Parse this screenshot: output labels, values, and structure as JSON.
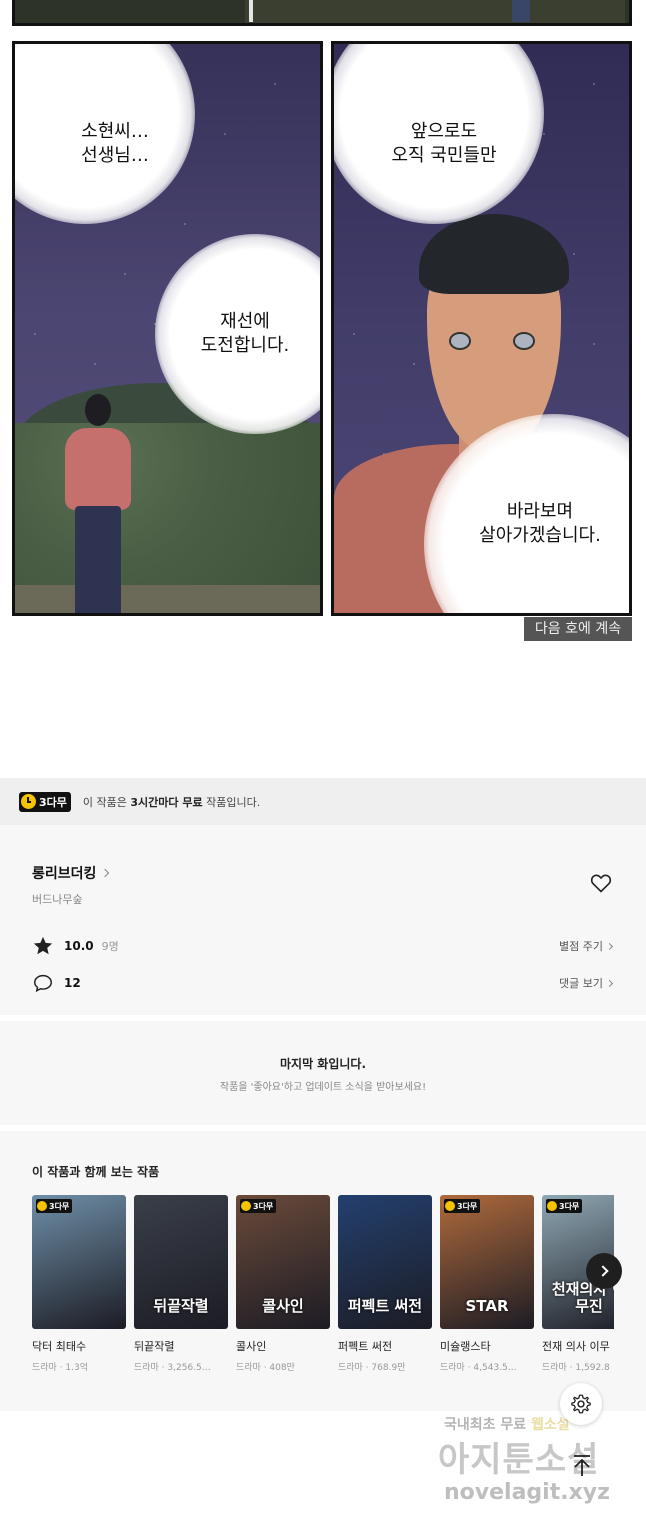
{
  "comic": {
    "bubble_1": "소현씨…\n선생님…",
    "bubble_2": "재선에\n도전합니다.",
    "bubble_3": "앞으로도\n오직 국민들만",
    "bubble_4": "바라보며\n살아가겠습니다.",
    "continued": "다음 호에 계속"
  },
  "free_banner": {
    "badge": "3다무",
    "text_prefix": "이 작품은 ",
    "text_bold": "3시간마다 무료",
    "text_suffix": " 작품입니다."
  },
  "work": {
    "title": "롱리브더킹",
    "author": "버드나무숲",
    "rating": "10.0",
    "rating_count": "9명",
    "rate_link": "별점 주기",
    "comment_count": "12",
    "comment_link": "댓글 보기"
  },
  "last_episode": {
    "title": "마지막 화입니다.",
    "subtitle": "작품을 '좋아요'하고 업데이트 소식을 받아보세요!"
  },
  "recommendations": {
    "heading": "이 작품과 함께 보는 작품",
    "items": [
      {
        "name": "닥터 최태수",
        "meta": "드라마 · 1.3억",
        "badge": "3다무",
        "thumb_text": "",
        "color": "#6f8fa8"
      },
      {
        "name": "뒤끝작렬",
        "meta": "드라마 · 3,256.5…",
        "badge": "",
        "thumb_text": "뒤끝작렬",
        "color": "#3a3f4a"
      },
      {
        "name": "콜사인",
        "meta": "드라마 · 408만",
        "badge": "3다무",
        "thumb_text": "콜사인",
        "color": "#6b4a3a"
      },
      {
        "name": "퍼펙트 써전",
        "meta": "드라마 · 768.9만",
        "badge": "",
        "thumb_text": "퍼펙트 써전",
        "color": "#23406e"
      },
      {
        "name": "미슐랭스타",
        "meta": "드라마 · 4,543.5…",
        "badge": "3다무",
        "thumb_text": "STAR",
        "color": "#b06a3c"
      },
      {
        "name": "전재 의사 이무",
        "meta": "드라마 · 1,592.8",
        "badge": "3다무",
        "thumb_text": "천재의사 이무진",
        "color": "#8fa8b4"
      }
    ]
  },
  "watermark": {
    "line1_a": "국내최초 무료",
    "line1_b": "웹소설",
    "line2": "아지툰소설",
    "line3": "novelagit.xyz"
  },
  "colors": {
    "accent": "#f5c400",
    "badge_bg": "#111111",
    "section_bg": "#f7f7f7"
  }
}
